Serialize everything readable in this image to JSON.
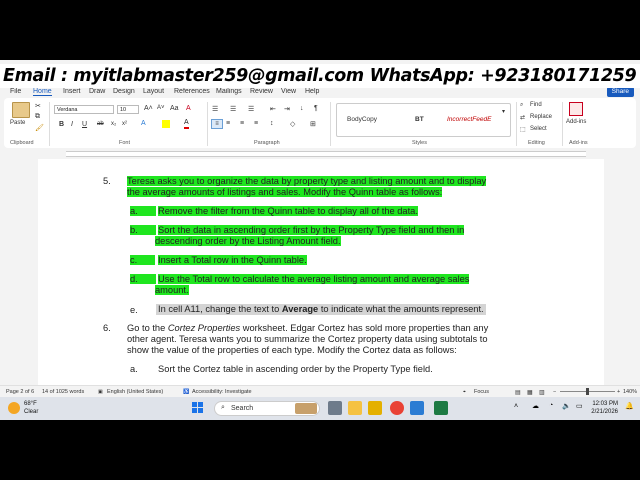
{
  "banner": {
    "text": "Email : myitlabmaster259@gmail.com  WhatsApp: +923180171259"
  },
  "menu": {
    "tabs": [
      "File",
      "Home",
      "Insert",
      "Draw",
      "Design",
      "Layout",
      "References",
      "Mailings",
      "Review",
      "View",
      "Help"
    ],
    "active": "Home",
    "share_label": "Share"
  },
  "ribbon": {
    "paste_label": "Paste",
    "font_name": "Verdana",
    "font_size": "10",
    "styles": [
      "BodyCopy",
      "BT",
      "IncorrectFeedE"
    ],
    "find_label": "Find",
    "replace_label": "Replace",
    "select_label": "Select",
    "addins_label": "Add-ins",
    "groups": {
      "clipboard": "Clipboard",
      "font": "Font",
      "paragraph": "Paragraph",
      "styles": "Styles",
      "editing": "Editing",
      "addins": "Add-ins"
    }
  },
  "document": {
    "item5": {
      "number": "5.",
      "line1": "Teresa asks you to organize the data by property type and listing amount and to display",
      "line2": "the average amounts of listings and sales. Modify the Quinn table as follows:",
      "a_marker": "a.",
      "a_text": "Remove the filter from the Quinn table to display all of the data.",
      "b_marker": "b.",
      "b_line1": "Sort the data in ascending order first by the Property Type field and then in",
      "b_line2": "descending order by the Listing Amount field.",
      "c_marker": "c.",
      "c_text": "Insert a Total row in the Quinn table.",
      "d_marker": "d.",
      "d_line1": "Use the Total row to calculate the average listing amount and average sales",
      "d_line2": "amount.",
      "e_marker": "e.",
      "e_text_before": "In cell A11, change the text to ",
      "e_text_bold": "Average",
      "e_text_after": " to indicate what the amounts represent."
    },
    "item6": {
      "number": "6.",
      "line1_before": "Go to the ",
      "line1_italic": "Cortez Properties",
      "line1_after": " worksheet. Edgar Cortez has sold more properties than any",
      "line2": "other agent. Teresa wants you to summarize the Cortez property data using subtotals to",
      "line3": "show the value of the properties of each type. Modify the Cortez data as follows:",
      "a_marker": "a.",
      "a_text": "Sort the Cortez table in ascending order by the Property Type field."
    }
  },
  "status": {
    "page": "Page 2 of 6",
    "words": "14 of 1025 words",
    "language": "English (United States)",
    "accessibility": "Accessibility: Investigate",
    "focus": "Focus",
    "zoom": "140%"
  },
  "taskbar": {
    "temperature": "68°F",
    "weather": "Clear",
    "search_label": "Search",
    "time": "12:03 PM",
    "date": "2/21/2026"
  }
}
